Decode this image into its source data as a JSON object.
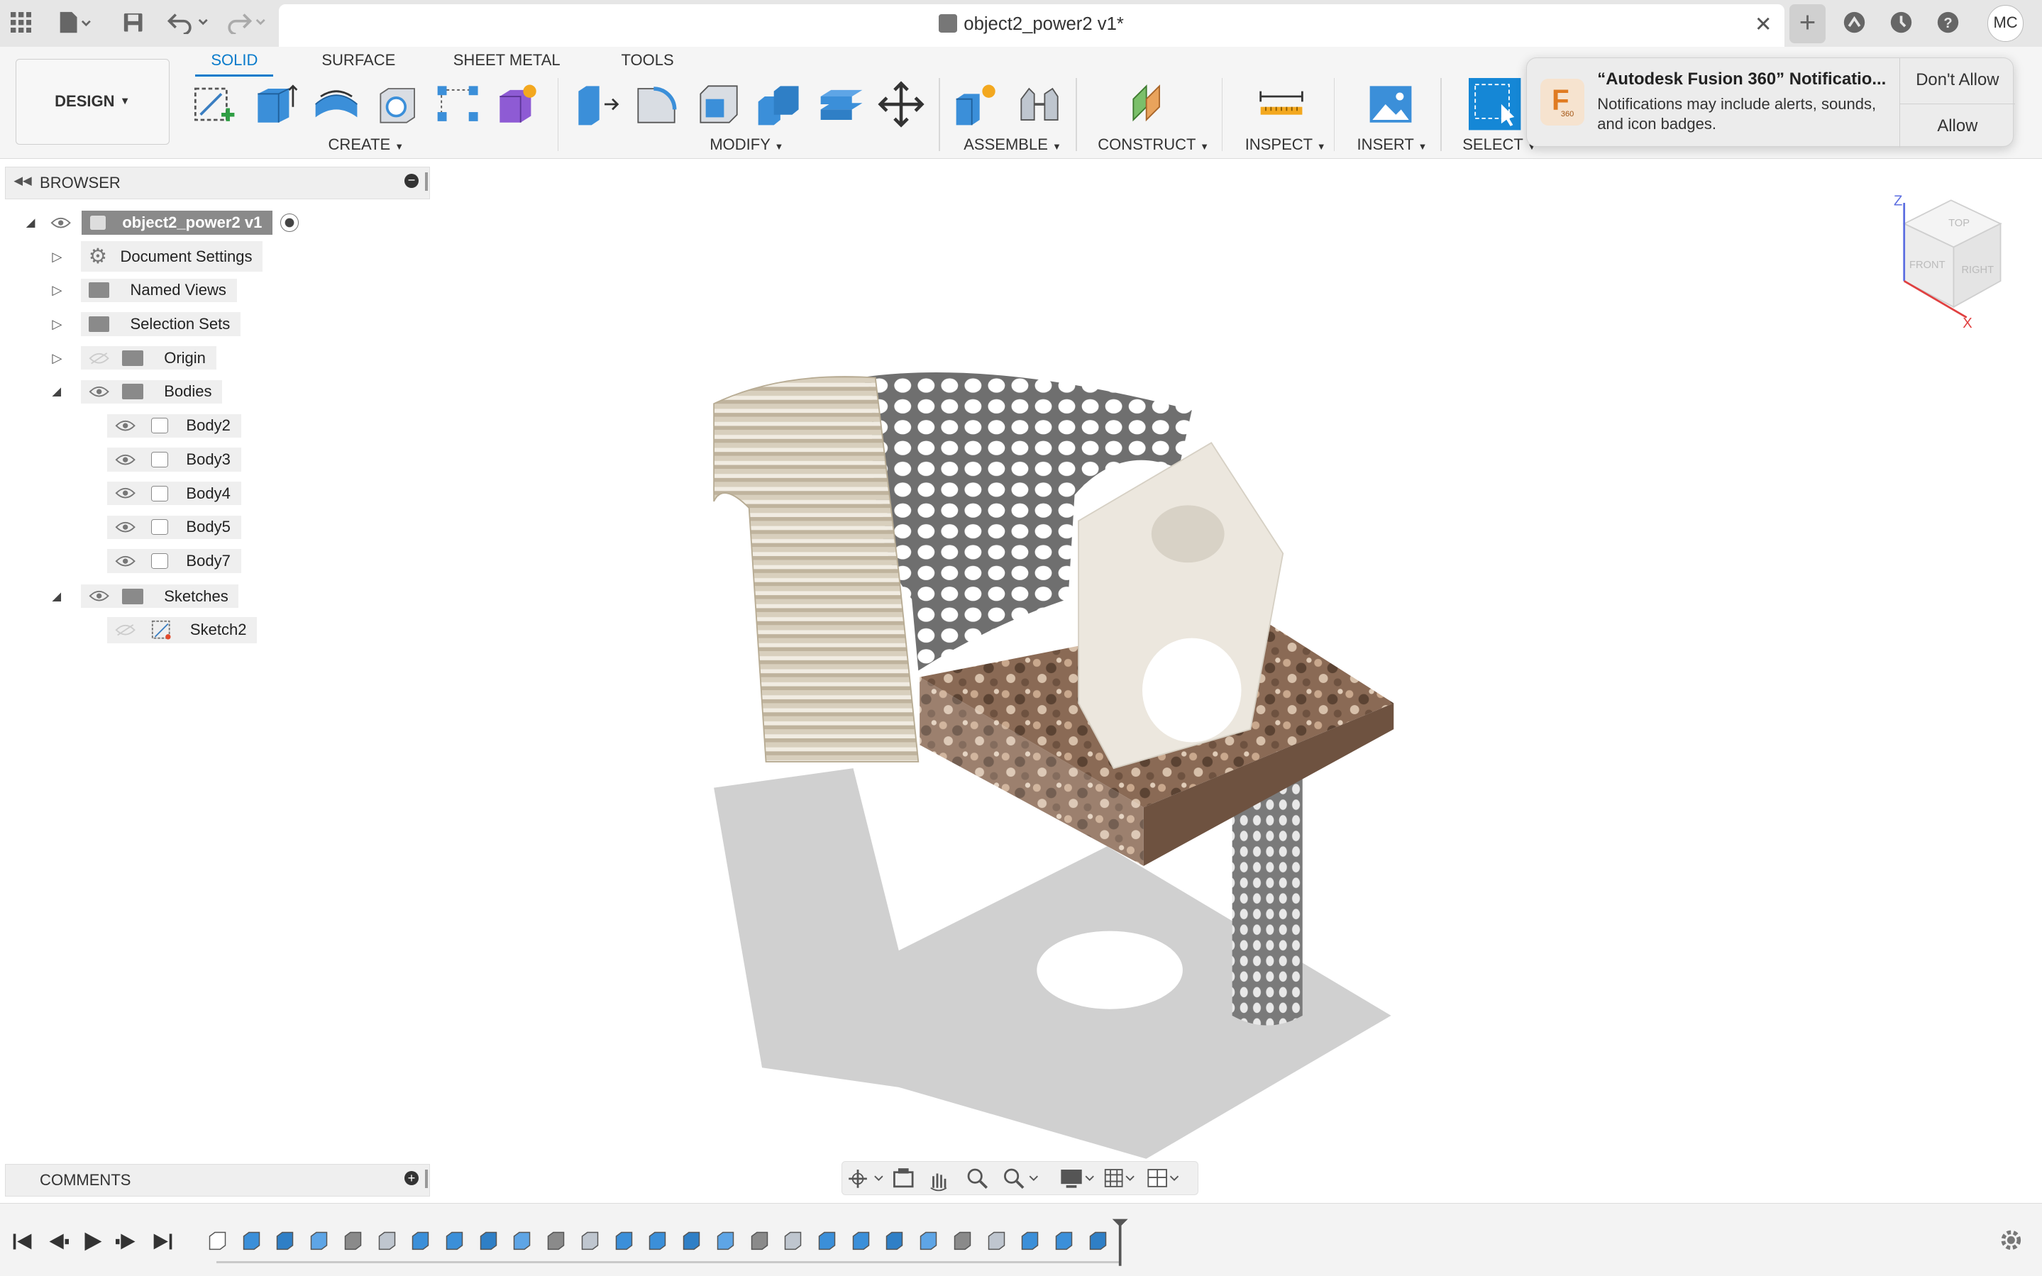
{
  "title_bar": {
    "document_title": "object2_power2 v1*",
    "user_initials": "MC",
    "icons": [
      "apps-grid-icon",
      "file-icon",
      "save-icon",
      "undo-icon",
      "redo-icon",
      "close-icon",
      "plus-icon",
      "extensions-icon",
      "job-status-icon",
      "help-icon"
    ]
  },
  "toolbar": {
    "workspace": "DESIGN",
    "tabs": [
      "SOLID",
      "SURFACE",
      "SHEET METAL",
      "TOOLS"
    ],
    "active_tab": "SOLID",
    "groups": {
      "create": "CREATE",
      "modify": "MODIFY",
      "assemble": "ASSEMBLE",
      "construct": "CONSTRUCT",
      "inspect": "INSPECT",
      "insert": "INSERT",
      "select": "SELECT"
    },
    "accent_color": "#0a7bcb"
  },
  "notification": {
    "title": "“Autodesk Fusion 360” Notificatio...",
    "body": "Notifications may include alerts, sounds, and icon badges.",
    "dont_allow": "Don't Allow",
    "allow": "Allow",
    "app_icon_text": "F",
    "app_icon_sub": "360"
  },
  "browser": {
    "title": "BROWSER",
    "root": "object2_power2 v1",
    "items": [
      {
        "label": "Document Settings"
      },
      {
        "label": "Named Views"
      },
      {
        "label": "Selection Sets"
      },
      {
        "label": "Origin"
      },
      {
        "label": "Bodies"
      },
      {
        "label": "Body2"
      },
      {
        "label": "Body3"
      },
      {
        "label": "Body4"
      },
      {
        "label": "Body5"
      },
      {
        "label": "Body7"
      },
      {
        "label": "Sketches"
      },
      {
        "label": "Sketch2"
      }
    ]
  },
  "comments": {
    "title": "COMMENTS"
  },
  "viewcube": {
    "top": "TOP",
    "front": "FRONT",
    "right": "RIGHT",
    "z_axis": "Z",
    "x_axis": "X"
  },
  "timeline": {
    "feature_count": 27
  }
}
